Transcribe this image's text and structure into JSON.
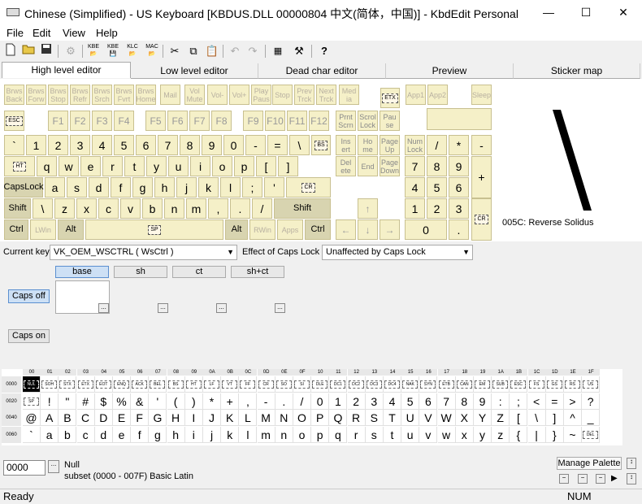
{
  "window": {
    "title": "Chinese (Simplified) - US Keyboard [KBDUS.DLL 00000804 中文(简体，中国)] - KbdEdit Personal",
    "minimize": "—",
    "maximize": "☐",
    "close": "✕"
  },
  "menu": [
    "File",
    "Edit",
    "View",
    "Help"
  ],
  "toolbar": [
    "new-icon",
    "open-icon",
    "save-icon",
    "disabled-icon",
    "kbe-icon",
    "kbe-icon",
    "klc-icon",
    "mac-icon",
    "cut-icon",
    "copy-icon",
    "paste-icon",
    "undo-icon",
    "redo-icon",
    "grid-icon",
    "tools-icon",
    "help-icon"
  ],
  "toolbar_labels": {
    "kbe": "KBE",
    "klc": "KLC",
    "mac": "MAC"
  },
  "tabs": [
    "High level editor",
    "Low level editor",
    "Dead char editor",
    "Preview",
    "Sticker map"
  ],
  "browser_keys": [
    "Brws Back",
    "Brws Forw",
    "Brws Stop",
    "Brws Refr",
    "Brws Srch",
    "Brws Fvrt",
    "Brws Home",
    "Mail",
    "Vol Mute",
    "Vol-",
    "Vol+",
    "Play Paus",
    "Stop",
    "Prev Trck",
    "Next Trck",
    "Med ia"
  ],
  "etx": "ETX",
  "app_keys": [
    "App1",
    "App2"
  ],
  "sleep": "Sleep",
  "esc": "ESC",
  "fkeys": [
    "F1",
    "F2",
    "F3",
    "F4",
    "F5",
    "F6",
    "F7",
    "F8",
    "F9",
    "F10",
    "F11",
    "F12"
  ],
  "nav_top": [
    "Prnt Scrn",
    "Scrol Lock",
    "Pau se"
  ],
  "row1": [
    "`",
    "1",
    "2",
    "3",
    "4",
    "5",
    "6",
    "7",
    "8",
    "9",
    "0",
    "-",
    "="
  ],
  "row1_back": "\\",
  "bs": "BS",
  "ins_row": [
    "Ins ert",
    "Ho me",
    "Page Up"
  ],
  "numlock": "Num Lock",
  "num_row1": [
    "/",
    "*",
    "-"
  ],
  "ht": "HT",
  "row2": [
    "q",
    "w",
    "e",
    "r",
    "t",
    "y",
    "u",
    "i",
    "o",
    "p",
    "[",
    "]"
  ],
  "del_row": [
    "Del ete",
    "End",
    "Page Down"
  ],
  "num_row2": [
    "7",
    "8",
    "9"
  ],
  "num_plus": "+",
  "capslock": "CapsLock",
  "row3": [
    "a",
    "s",
    "d",
    "f",
    "g",
    "h",
    "j",
    "k",
    "l",
    ";",
    "'"
  ],
  "cr": "CR",
  "num_row3": [
    "4",
    "5",
    "6"
  ],
  "shift_l": "Shift",
  "row4": [
    "\\",
    "z",
    "x",
    "c",
    "v",
    "b",
    "n",
    "m",
    ",",
    ".",
    "/"
  ],
  "shift_r": "Shift",
  "arrow_up": "↑",
  "num_row4": [
    "1",
    "2",
    "3"
  ],
  "ctrl": "Ctrl",
  "lwin": "LWin",
  "alt": "Alt",
  "sp": "SP",
  "altgr": "Alt",
  "rwin": "RWin",
  "apps": "Apps",
  "ctrl_r": "Ctrl",
  "arrows": [
    "←",
    "↓",
    "→"
  ],
  "num0": "0",
  "numdot": ".",
  "preview": {
    "glyph": "\\",
    "caption": "005C: Reverse Solidus"
  },
  "current_key": {
    "label": "Current key",
    "value": "VK_OEM_WSCTRL ( WsCtrl )"
  },
  "caps_effect": {
    "label": "Effect of Caps Lock",
    "value": "Unaffected by Caps Lock"
  },
  "shift_states": [
    "base",
    "sh",
    "ct",
    "sh+ct"
  ],
  "caps_off": "Caps off",
  "caps_on": "Caps on",
  "dots": "...",
  "grid": {
    "cols": [
      "00",
      "01",
      "02",
      "03",
      "04",
      "05",
      "06",
      "07",
      "08",
      "09",
      "0A",
      "0B",
      "0C",
      "0D",
      "0E",
      "0F",
      "10",
      "11",
      "12",
      "13",
      "14",
      "15",
      "16",
      "17",
      "18",
      "19",
      "1A",
      "1B",
      "1C",
      "1D",
      "1E",
      "1F"
    ],
    "rows": [
      "0000",
      "0020",
      "0040",
      "0060"
    ],
    "r0": [
      "NUL",
      "SOH",
      "STX",
      "ETX",
      "EOT",
      "ENQ",
      "ACK",
      "BEL",
      "BS",
      "HT",
      "LF",
      "VT",
      "FF",
      "CR",
      "SO",
      "SI",
      "DLE",
      "DC1",
      "DC2",
      "DC3",
      "DC4",
      "NAK",
      "SYN",
      "ETB",
      "CAN",
      "EM",
      "SUB",
      "ESC",
      "FS",
      "GS",
      "RS",
      "US"
    ],
    "r1": [
      "SP",
      "!",
      "\"",
      "#",
      "$",
      "%",
      "&",
      "'",
      "(",
      ")",
      "*",
      "+",
      ",",
      "-",
      ".",
      "/",
      "0",
      "1",
      "2",
      "3",
      "4",
      "5",
      "6",
      "7",
      "8",
      "9",
      ":",
      ";",
      "<",
      "=",
      ">",
      "?"
    ],
    "r2": [
      "@",
      "A",
      "B",
      "C",
      "D",
      "E",
      "F",
      "G",
      "H",
      "I",
      "J",
      "K",
      "L",
      "M",
      "N",
      "O",
      "P",
      "Q",
      "R",
      "S",
      "T",
      "U",
      "V",
      "W",
      "X",
      "Y",
      "Z",
      "[",
      "\\",
      "]",
      "^",
      "_"
    ],
    "r3": [
      "`",
      "a",
      "b",
      "c",
      "d",
      "e",
      "f",
      "g",
      "h",
      "i",
      "j",
      "k",
      "l",
      "m",
      "n",
      "o",
      "p",
      "q",
      "r",
      "s",
      "t",
      "u",
      "v",
      "w",
      "x",
      "y",
      "z",
      "{",
      "|",
      "}",
      "~",
      "DEL"
    ]
  },
  "code": {
    "value": "0000",
    "name": "Null",
    "subset": "subset (0000 - 007F) Basic Latin"
  },
  "manage_palette": "Manage Palette",
  "status": {
    "left": "Ready",
    "num": "NUM"
  }
}
